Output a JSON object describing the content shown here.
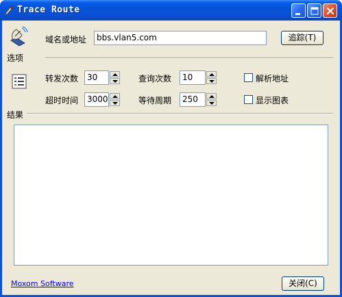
{
  "window": {
    "title": "Trace Route"
  },
  "icons": {
    "options_icon": "satellite-dish-icon",
    "results_icon": "list-icon"
  },
  "labels": {
    "options": "选项",
    "results": "结果"
  },
  "host": {
    "label": "域名或地址",
    "value": "bbs.vlan5.com"
  },
  "trace_button": "追踪(T)",
  "settings": {
    "hops_label": "转发次数",
    "hops_value": "30",
    "queries_label": "查询次数",
    "queries_value": "10",
    "timeout_label": "超时时间",
    "timeout_value": "3000",
    "wait_label": "等待周期",
    "wait_value": "250"
  },
  "checkboxes": {
    "resolve_label": "解析地址",
    "resolve_checked": false,
    "chart_label": "显示图表",
    "chart_checked": false
  },
  "footer": {
    "link": "Moxom Software",
    "close_button": "关闭(C)"
  }
}
